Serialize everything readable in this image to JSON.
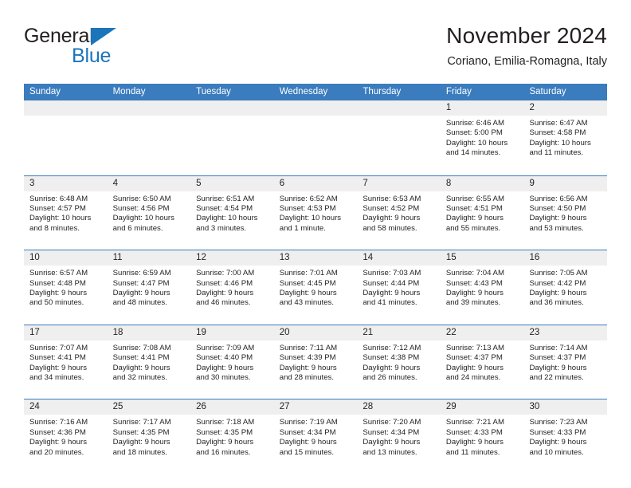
{
  "brand": {
    "line1": "General",
    "line2": "Blue",
    "triangle_color": "#1B75BB"
  },
  "header": {
    "title": "November 2024",
    "location": "Coriano, Emilia-Romagna, Italy"
  },
  "theme": {
    "header_blue": "#3A7CBE",
    "day_band_gray": "#EFEFEF",
    "text": "#231F20"
  },
  "weekdays": [
    "Sunday",
    "Monday",
    "Tuesday",
    "Wednesday",
    "Thursday",
    "Friday",
    "Saturday"
  ],
  "weeks": [
    [
      {
        "empty": true
      },
      {
        "empty": true
      },
      {
        "empty": true
      },
      {
        "empty": true
      },
      {
        "empty": true
      },
      {
        "day": "1",
        "sunrise": "Sunrise: 6:46 AM",
        "sunset": "Sunset: 5:00 PM",
        "daylight_line1": "Daylight: 10 hours",
        "daylight_line2": "and 14 minutes."
      },
      {
        "day": "2",
        "sunrise": "Sunrise: 6:47 AM",
        "sunset": "Sunset: 4:58 PM",
        "daylight_line1": "Daylight: 10 hours",
        "daylight_line2": "and 11 minutes."
      }
    ],
    [
      {
        "day": "3",
        "sunrise": "Sunrise: 6:48 AM",
        "sunset": "Sunset: 4:57 PM",
        "daylight_line1": "Daylight: 10 hours",
        "daylight_line2": "and 8 minutes."
      },
      {
        "day": "4",
        "sunrise": "Sunrise: 6:50 AM",
        "sunset": "Sunset: 4:56 PM",
        "daylight_line1": "Daylight: 10 hours",
        "daylight_line2": "and 6 minutes."
      },
      {
        "day": "5",
        "sunrise": "Sunrise: 6:51 AM",
        "sunset": "Sunset: 4:54 PM",
        "daylight_line1": "Daylight: 10 hours",
        "daylight_line2": "and 3 minutes."
      },
      {
        "day": "6",
        "sunrise": "Sunrise: 6:52 AM",
        "sunset": "Sunset: 4:53 PM",
        "daylight_line1": "Daylight: 10 hours",
        "daylight_line2": "and 1 minute."
      },
      {
        "day": "7",
        "sunrise": "Sunrise: 6:53 AM",
        "sunset": "Sunset: 4:52 PM",
        "daylight_line1": "Daylight: 9 hours",
        "daylight_line2": "and 58 minutes."
      },
      {
        "day": "8",
        "sunrise": "Sunrise: 6:55 AM",
        "sunset": "Sunset: 4:51 PM",
        "daylight_line1": "Daylight: 9 hours",
        "daylight_line2": "and 55 minutes."
      },
      {
        "day": "9",
        "sunrise": "Sunrise: 6:56 AM",
        "sunset": "Sunset: 4:50 PM",
        "daylight_line1": "Daylight: 9 hours",
        "daylight_line2": "and 53 minutes."
      }
    ],
    [
      {
        "day": "10",
        "sunrise": "Sunrise: 6:57 AM",
        "sunset": "Sunset: 4:48 PM",
        "daylight_line1": "Daylight: 9 hours",
        "daylight_line2": "and 50 minutes."
      },
      {
        "day": "11",
        "sunrise": "Sunrise: 6:59 AM",
        "sunset": "Sunset: 4:47 PM",
        "daylight_line1": "Daylight: 9 hours",
        "daylight_line2": "and 48 minutes."
      },
      {
        "day": "12",
        "sunrise": "Sunrise: 7:00 AM",
        "sunset": "Sunset: 4:46 PM",
        "daylight_line1": "Daylight: 9 hours",
        "daylight_line2": "and 46 minutes."
      },
      {
        "day": "13",
        "sunrise": "Sunrise: 7:01 AM",
        "sunset": "Sunset: 4:45 PM",
        "daylight_line1": "Daylight: 9 hours",
        "daylight_line2": "and 43 minutes."
      },
      {
        "day": "14",
        "sunrise": "Sunrise: 7:03 AM",
        "sunset": "Sunset: 4:44 PM",
        "daylight_line1": "Daylight: 9 hours",
        "daylight_line2": "and 41 minutes."
      },
      {
        "day": "15",
        "sunrise": "Sunrise: 7:04 AM",
        "sunset": "Sunset: 4:43 PM",
        "daylight_line1": "Daylight: 9 hours",
        "daylight_line2": "and 39 minutes."
      },
      {
        "day": "16",
        "sunrise": "Sunrise: 7:05 AM",
        "sunset": "Sunset: 4:42 PM",
        "daylight_line1": "Daylight: 9 hours",
        "daylight_line2": "and 36 minutes."
      }
    ],
    [
      {
        "day": "17",
        "sunrise": "Sunrise: 7:07 AM",
        "sunset": "Sunset: 4:41 PM",
        "daylight_line1": "Daylight: 9 hours",
        "daylight_line2": "and 34 minutes."
      },
      {
        "day": "18",
        "sunrise": "Sunrise: 7:08 AM",
        "sunset": "Sunset: 4:41 PM",
        "daylight_line1": "Daylight: 9 hours",
        "daylight_line2": "and 32 minutes."
      },
      {
        "day": "19",
        "sunrise": "Sunrise: 7:09 AM",
        "sunset": "Sunset: 4:40 PM",
        "daylight_line1": "Daylight: 9 hours",
        "daylight_line2": "and 30 minutes."
      },
      {
        "day": "20",
        "sunrise": "Sunrise: 7:11 AM",
        "sunset": "Sunset: 4:39 PM",
        "daylight_line1": "Daylight: 9 hours",
        "daylight_line2": "and 28 minutes."
      },
      {
        "day": "21",
        "sunrise": "Sunrise: 7:12 AM",
        "sunset": "Sunset: 4:38 PM",
        "daylight_line1": "Daylight: 9 hours",
        "daylight_line2": "and 26 minutes."
      },
      {
        "day": "22",
        "sunrise": "Sunrise: 7:13 AM",
        "sunset": "Sunset: 4:37 PM",
        "daylight_line1": "Daylight: 9 hours",
        "daylight_line2": "and 24 minutes."
      },
      {
        "day": "23",
        "sunrise": "Sunrise: 7:14 AM",
        "sunset": "Sunset: 4:37 PM",
        "daylight_line1": "Daylight: 9 hours",
        "daylight_line2": "and 22 minutes."
      }
    ],
    [
      {
        "day": "24",
        "sunrise": "Sunrise: 7:16 AM",
        "sunset": "Sunset: 4:36 PM",
        "daylight_line1": "Daylight: 9 hours",
        "daylight_line2": "and 20 minutes."
      },
      {
        "day": "25",
        "sunrise": "Sunrise: 7:17 AM",
        "sunset": "Sunset: 4:35 PM",
        "daylight_line1": "Daylight: 9 hours",
        "daylight_line2": "and 18 minutes."
      },
      {
        "day": "26",
        "sunrise": "Sunrise: 7:18 AM",
        "sunset": "Sunset: 4:35 PM",
        "daylight_line1": "Daylight: 9 hours",
        "daylight_line2": "and 16 minutes."
      },
      {
        "day": "27",
        "sunrise": "Sunrise: 7:19 AM",
        "sunset": "Sunset: 4:34 PM",
        "daylight_line1": "Daylight: 9 hours",
        "daylight_line2": "and 15 minutes."
      },
      {
        "day": "28",
        "sunrise": "Sunrise: 7:20 AM",
        "sunset": "Sunset: 4:34 PM",
        "daylight_line1": "Daylight: 9 hours",
        "daylight_line2": "and 13 minutes."
      },
      {
        "day": "29",
        "sunrise": "Sunrise: 7:21 AM",
        "sunset": "Sunset: 4:33 PM",
        "daylight_line1": "Daylight: 9 hours",
        "daylight_line2": "and 11 minutes."
      },
      {
        "day": "30",
        "sunrise": "Sunrise: 7:23 AM",
        "sunset": "Sunset: 4:33 PM",
        "daylight_line1": "Daylight: 9 hours",
        "daylight_line2": "and 10 minutes."
      }
    ]
  ]
}
